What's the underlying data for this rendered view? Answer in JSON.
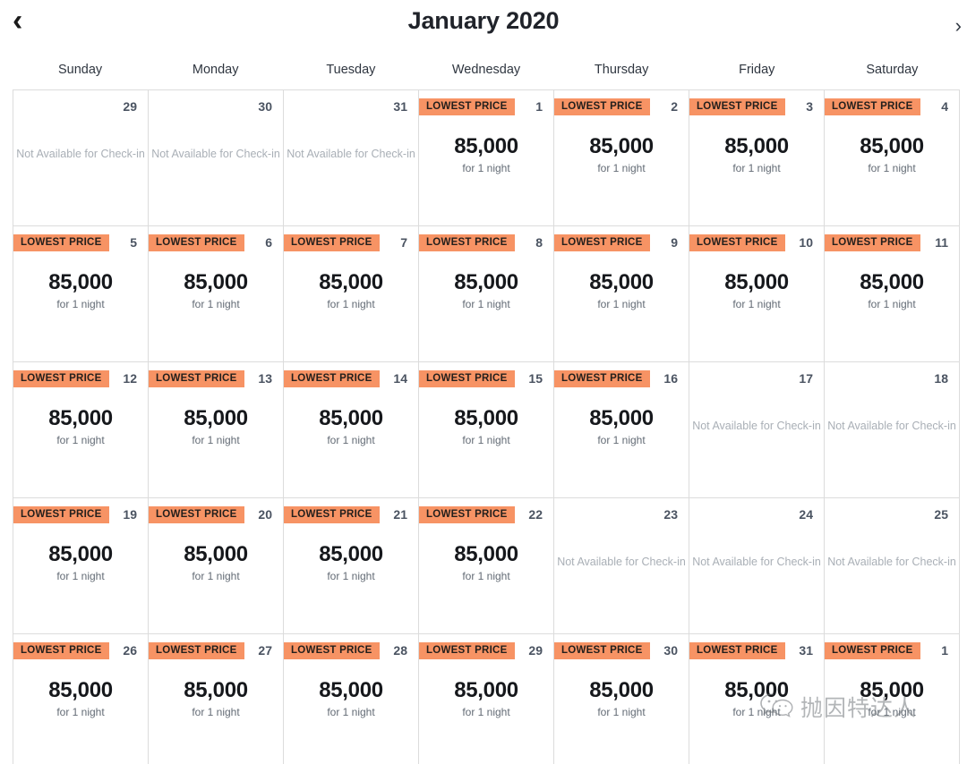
{
  "header": {
    "title": "January 2020",
    "prev_icon": "chevron-left-icon",
    "prev_glyph": "‹",
    "next_icon": "chevron-right-icon",
    "next_glyph": "›"
  },
  "weekdays": [
    "Sunday",
    "Monday",
    "Tuesday",
    "Wednesday",
    "Thursday",
    "Friday",
    "Saturday"
  ],
  "labels": {
    "badge": "LOWEST PRICE",
    "price": "85,000",
    "price_note": "for 1 night",
    "unavailable": "Not Available for Check-in"
  },
  "colors": {
    "badge_background": "#f79364",
    "badge_text": "#231f1c",
    "price_text": "#16181c",
    "day_number": "#4a5361",
    "unavailable_text": "#a9afb6",
    "grid_line": "#dcdcdc",
    "page_background": "#ffffff"
  },
  "watermark": {
    "text": "抛因特达人",
    "logo": "wechat-icon"
  },
  "weeks": [
    [
      {
        "day": "29",
        "available": false
      },
      {
        "day": "30",
        "available": false
      },
      {
        "day": "31",
        "available": false
      },
      {
        "day": "1",
        "available": true,
        "badge": "LOWEST PRICE",
        "price": "85,000",
        "note": "for 1 night"
      },
      {
        "day": "2",
        "available": true,
        "badge": "LOWEST PRICE",
        "price": "85,000",
        "note": "for 1 night"
      },
      {
        "day": "3",
        "available": true,
        "badge": "LOWEST PRICE",
        "price": "85,000",
        "note": "for 1 night"
      },
      {
        "day": "4",
        "available": true,
        "badge": "LOWEST PRICE",
        "price": "85,000",
        "note": "for 1 night"
      }
    ],
    [
      {
        "day": "5",
        "available": true,
        "badge": "LOWEST PRICE",
        "price": "85,000",
        "note": "for 1 night"
      },
      {
        "day": "6",
        "available": true,
        "badge": "LOWEST PRICE",
        "price": "85,000",
        "note": "for 1 night"
      },
      {
        "day": "7",
        "available": true,
        "badge": "LOWEST PRICE",
        "price": "85,000",
        "note": "for 1 night"
      },
      {
        "day": "8",
        "available": true,
        "badge": "LOWEST PRICE",
        "price": "85,000",
        "note": "for 1 night"
      },
      {
        "day": "9",
        "available": true,
        "badge": "LOWEST PRICE",
        "price": "85,000",
        "note": "for 1 night"
      },
      {
        "day": "10",
        "available": true,
        "badge": "LOWEST PRICE",
        "price": "85,000",
        "note": "for 1 night"
      },
      {
        "day": "11",
        "available": true,
        "badge": "LOWEST PRICE",
        "price": "85,000",
        "note": "for 1 night"
      }
    ],
    [
      {
        "day": "12",
        "available": true,
        "badge": "LOWEST PRICE",
        "price": "85,000",
        "note": "for 1 night"
      },
      {
        "day": "13",
        "available": true,
        "badge": "LOWEST PRICE",
        "price": "85,000",
        "note": "for 1 night"
      },
      {
        "day": "14",
        "available": true,
        "badge": "LOWEST PRICE",
        "price": "85,000",
        "note": "for 1 night"
      },
      {
        "day": "15",
        "available": true,
        "badge": "LOWEST PRICE",
        "price": "85,000",
        "note": "for 1 night"
      },
      {
        "day": "16",
        "available": true,
        "badge": "LOWEST PRICE",
        "price": "85,000",
        "note": "for 1 night"
      },
      {
        "day": "17",
        "available": false
      },
      {
        "day": "18",
        "available": false
      }
    ],
    [
      {
        "day": "19",
        "available": true,
        "badge": "LOWEST PRICE",
        "price": "85,000",
        "note": "for 1 night"
      },
      {
        "day": "20",
        "available": true,
        "badge": "LOWEST PRICE",
        "price": "85,000",
        "note": "for 1 night"
      },
      {
        "day": "21",
        "available": true,
        "badge": "LOWEST PRICE",
        "price": "85,000",
        "note": "for 1 night"
      },
      {
        "day": "22",
        "available": true,
        "badge": "LOWEST PRICE",
        "price": "85,000",
        "note": "for 1 night"
      },
      {
        "day": "23",
        "available": false
      },
      {
        "day": "24",
        "available": false
      },
      {
        "day": "25",
        "available": false
      }
    ],
    [
      {
        "day": "26",
        "available": true,
        "badge": "LOWEST PRICE",
        "price": "85,000",
        "note": "for 1 night"
      },
      {
        "day": "27",
        "available": true,
        "badge": "LOWEST PRICE",
        "price": "85,000",
        "note": "for 1 night"
      },
      {
        "day": "28",
        "available": true,
        "badge": "LOWEST PRICE",
        "price": "85,000",
        "note": "for 1 night"
      },
      {
        "day": "29",
        "available": true,
        "badge": "LOWEST PRICE",
        "price": "85,000",
        "note": "for 1 night"
      },
      {
        "day": "30",
        "available": true,
        "badge": "LOWEST PRICE",
        "price": "85,000",
        "note": "for 1 night"
      },
      {
        "day": "31",
        "available": true,
        "badge": "LOWEST PRICE",
        "price": "85,000",
        "note": "for 1 night"
      },
      {
        "day": "1",
        "available": true,
        "badge": "LOWEST PRICE",
        "price": "85,000",
        "note": "for 1 night"
      }
    ]
  ]
}
